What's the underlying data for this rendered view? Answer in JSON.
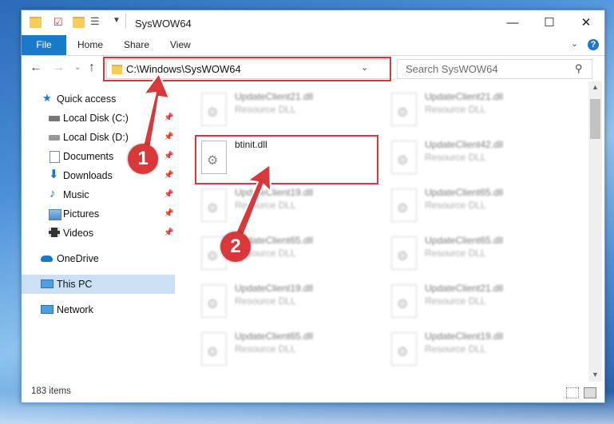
{
  "window": {
    "title": "SysWOW64",
    "minimize": "—",
    "maximize": "☐",
    "close": "✕"
  },
  "ribbon": {
    "tabs": [
      "File",
      "Home",
      "Share",
      "View"
    ],
    "help": "?"
  },
  "nav": {
    "address": "C:\\Windows\\SysWOW64",
    "search_placeholder": "Search SysWOW64"
  },
  "sidebar": {
    "items": [
      {
        "label": "Quick access",
        "pinned": false
      },
      {
        "label": "Local Disk (C:)",
        "pinned": true
      },
      {
        "label": "Local Disk (D:)",
        "pinned": true
      },
      {
        "label": "Documents",
        "pinned": true
      },
      {
        "label": "Downloads",
        "pinned": true
      },
      {
        "label": "Music",
        "pinned": true
      },
      {
        "label": "Pictures",
        "pinned": true
      },
      {
        "label": "Videos",
        "pinned": true
      },
      {
        "label": "OneDrive",
        "pinned": false
      },
      {
        "label": "This PC",
        "pinned": false,
        "selected": true
      },
      {
        "label": "Network",
        "pinned": false
      }
    ]
  },
  "files": [
    {
      "name": "UpdateClient21.dll",
      "type": "Resource DLL",
      "blurred": true
    },
    {
      "name": "UpdateClient21.dll",
      "type": "Resource DLL",
      "blurred": true
    },
    {
      "name": "btinit.dll",
      "type": "",
      "blurred": false,
      "highlighted": true
    },
    {
      "name": "UpdateClient42.dll",
      "type": "Resource DLL",
      "blurred": true
    },
    {
      "name": "UpdateClient19.dll",
      "type": "Resource DLL",
      "blurred": true
    },
    {
      "name": "UpdateClient65.dll",
      "type": "Resource DLL",
      "blurred": true
    },
    {
      "name": "UpdateClient65.dll",
      "type": "Resource DLL",
      "blurred": true
    },
    {
      "name": "UpdateClient65.dll",
      "type": "Resource DLL",
      "blurred": true
    },
    {
      "name": "UpdateClient19.dll",
      "type": "Resource DLL",
      "blurred": true
    },
    {
      "name": "UpdateClient21.dll",
      "type": "Resource DLL",
      "blurred": true
    },
    {
      "name": "UpdateClient65.dll",
      "type": "Resource DLL",
      "blurred": true
    },
    {
      "name": "UpdateClient19.dll",
      "type": "Resource DLL",
      "blurred": true
    }
  ],
  "status": {
    "item_count": "183 items"
  },
  "annotations": {
    "step1": "1",
    "step2": "2",
    "color": "#d9383a"
  }
}
